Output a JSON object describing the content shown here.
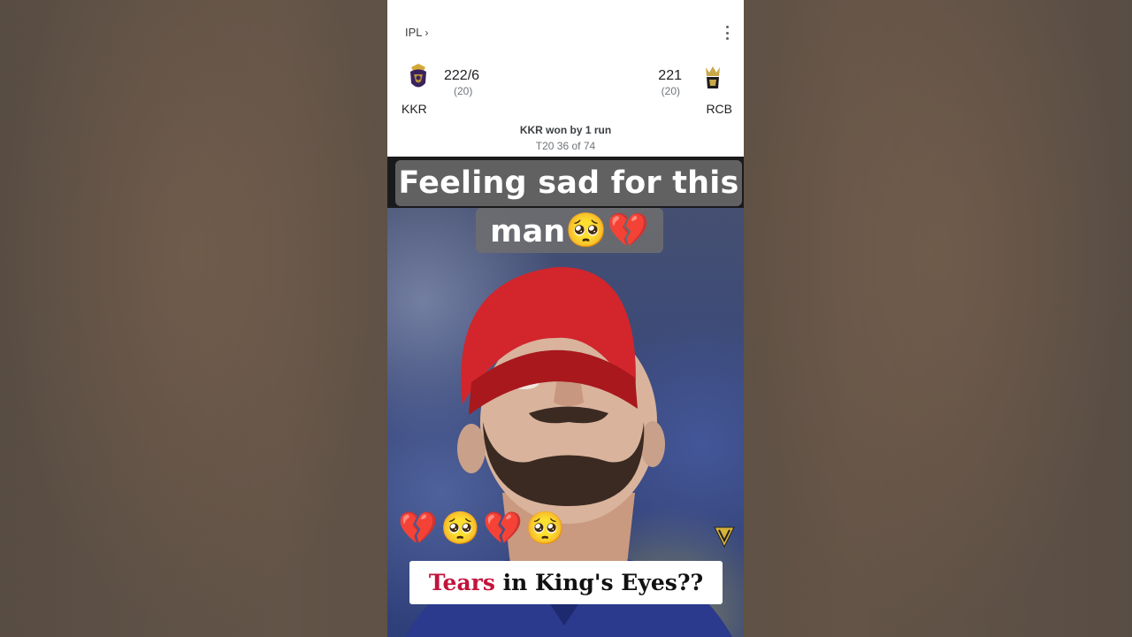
{
  "scorecard": {
    "league": "IPL",
    "team_left": {
      "name": "KKR",
      "score": "222/6",
      "overs": "(20)"
    },
    "team_right": {
      "name": "RCB",
      "score": "221",
      "overs": "(20)"
    },
    "result": "KKR won by 1 run",
    "match_info": "T20 36 of 74"
  },
  "video": {
    "caption_line1": "Feeling sad for this",
    "caption_line2": "man",
    "caption_line2_emojis": "🥺💔",
    "emoji_row": [
      "💔",
      "🥺",
      "💔",
      "🥺"
    ],
    "banner_highlight": "Tears",
    "banner_rest": " in King's Eyes??"
  },
  "colors": {
    "banner_highlight": "#c2143c",
    "cap_red": "#d2262c"
  }
}
